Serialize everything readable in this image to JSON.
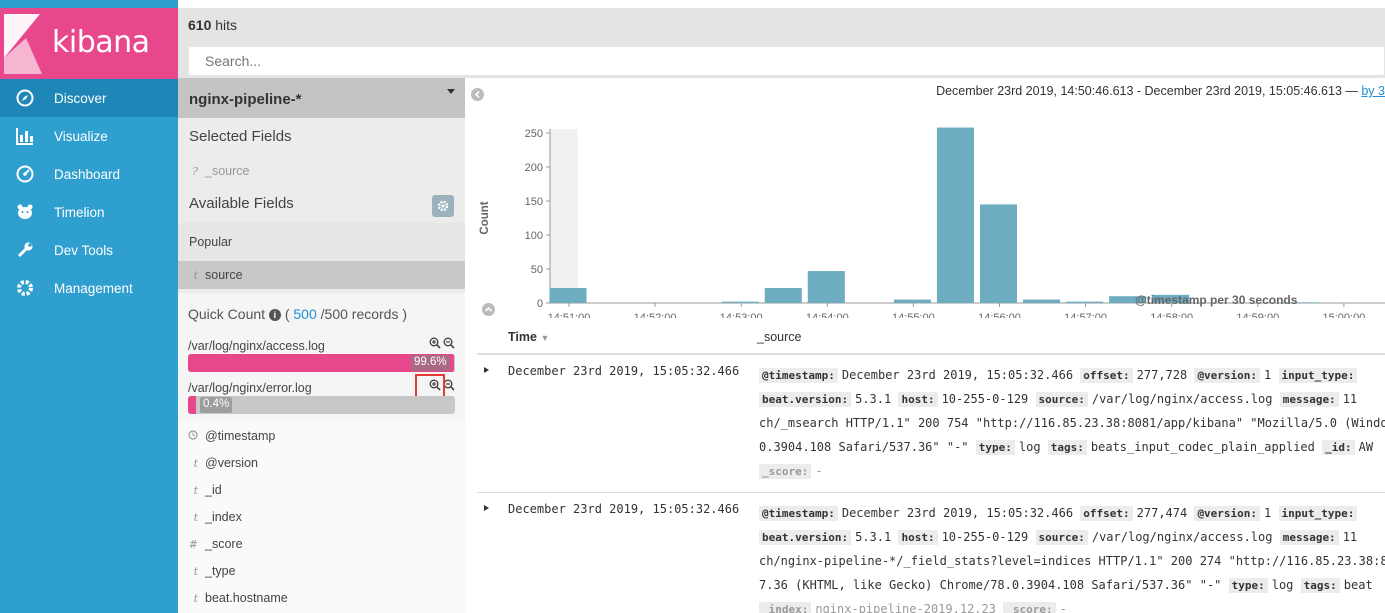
{
  "brand": {
    "name": "kibana",
    "color": "#e8478b"
  },
  "nav": [
    {
      "label": "Discover",
      "icon": "compass-icon",
      "active": true
    },
    {
      "label": "Visualize",
      "icon": "bar-chart-icon"
    },
    {
      "label": "Dashboard",
      "icon": "dashboard-icon"
    },
    {
      "label": "Timelion",
      "icon": "bear-icon"
    },
    {
      "label": "Dev Tools",
      "icon": "wrench-icon"
    },
    {
      "label": "Management",
      "icon": "gear-icon"
    }
  ],
  "header": {
    "hits_count": "610",
    "hits_label": "hits",
    "search_placeholder": "Search..."
  },
  "sidebar": {
    "index_pattern": "nginx-pipeline-*",
    "selected_fields_title": "Selected Fields",
    "selected_fields": [
      {
        "type": "?",
        "name": "_source"
      }
    ],
    "available_fields_title": "Available Fields",
    "popular_title": "Popular",
    "popular_fields": [
      {
        "type": "t",
        "name": "source"
      }
    ],
    "quick_count": {
      "title": "Quick Count",
      "open": "(",
      "count": "500",
      "rest": "/500 records )",
      "rows": [
        {
          "label": "/var/log/nginx/access.log",
          "pct": "99.6%",
          "fraction": 0.996
        },
        {
          "label": "/var/log/nginx/error.log",
          "pct": "0.4%",
          "fraction": 0.004
        }
      ]
    },
    "fields": [
      {
        "type": "clock",
        "name": "@timestamp"
      },
      {
        "type": "t",
        "name": "@version"
      },
      {
        "type": "t",
        "name": "_id"
      },
      {
        "type": "t",
        "name": "_index"
      },
      {
        "type": "#",
        "name": "_score"
      },
      {
        "type": "t",
        "name": "_type"
      },
      {
        "type": "t",
        "name": "beat.hostname"
      }
    ]
  },
  "time_range": {
    "text": "December 23rd 2019, 14:50:46.613 - December 23rd 2019, 15:05:46.613 —",
    "link": "by 3"
  },
  "chart_data": {
    "type": "bar",
    "title": "",
    "xlabel": "@timestamp per 30 seconds",
    "ylabel": "Count",
    "ylim": [
      0,
      250
    ],
    "yticks": [
      "0",
      "50",
      "100",
      "150",
      "200",
      "250"
    ],
    "xticks": [
      "14:51:00",
      "14:52:00",
      "14:53:00",
      "14:54:00",
      "14:55:00",
      "14:56:00",
      "14:57:00",
      "14:58:00",
      "14:59:00",
      "15:00:00"
    ],
    "bar_color": "#6eadc1",
    "x": [
      "14:51:00",
      "14:53:30",
      "14:54:00",
      "14:54:30",
      "14:55:30",
      "14:56:00",
      "14:56:30",
      "14:57:00",
      "14:57:30",
      "14:58:00",
      "14:58:30",
      "15:00:00"
    ],
    "values": [
      22,
      0,
      2,
      22,
      47,
      5,
      258,
      145,
      5,
      2,
      10,
      12,
      1
    ]
  },
  "table": {
    "time_header": "Time",
    "source_header": "_source",
    "rows": [
      {
        "time": "December 23rd 2019, 15:05:32.466",
        "lines": [
          [
            [
              "@timestamp:",
              "December 23rd 2019, 15:05:32.466"
            ],
            [
              "offset:",
              "277,728"
            ],
            [
              "@version:",
              "1"
            ],
            [
              "input_type:",
              ""
            ]
          ],
          [
            [
              "beat.version:",
              "5.3.1"
            ],
            [
              "host:",
              "10-255-0-129"
            ],
            [
              "source:",
              "/var/log/nginx/access.log"
            ],
            [
              "message:",
              "11"
            ]
          ],
          [
            [
              "",
              "ch/_msearch HTTP/1.1\" 200 754 \"http://116.85.23.38:8081/app/kibana\" \"Mozilla/5.0 (Windo"
            ]
          ],
          [
            [
              "",
              "0.3904.108 Safari/537.36\" \"-\""
            ],
            [
              "type:",
              "log"
            ],
            [
              "tags:",
              "beats_input_codec_plain_applied"
            ],
            [
              "_id:",
              "AW"
            ]
          ],
          [
            [
              "_score:",
              "-"
            ]
          ]
        ]
      },
      {
        "time": "December 23rd 2019, 15:05:32.466",
        "lines": [
          [
            [
              "@timestamp:",
              "December 23rd 2019, 15:05:32.466"
            ],
            [
              "offset:",
              "277,474"
            ],
            [
              "@version:",
              "1"
            ],
            [
              "input_type:",
              ""
            ]
          ],
          [
            [
              "beat.version:",
              "5.3.1"
            ],
            [
              "host:",
              "10-255-0-129"
            ],
            [
              "source:",
              "/var/log/nginx/access.log"
            ],
            [
              "message:",
              "11"
            ]
          ],
          [
            [
              "",
              "ch/nginx-pipeline-*/_field_stats?level=indices HTTP/1.1\" 200 274 \"http://116.85.23.38:8"
            ]
          ],
          [
            [
              "",
              "7.36 (KHTML, like Gecko) Chrome/78.0.3904.108 Safari/537.36\" \"-\""
            ],
            [
              "type:",
              "log"
            ],
            [
              "tags:",
              "beat"
            ]
          ],
          [
            [
              "_index:",
              "nginx-pipeline-2019.12.23"
            ],
            [
              "_score:",
              "-"
            ]
          ]
        ]
      }
    ]
  }
}
